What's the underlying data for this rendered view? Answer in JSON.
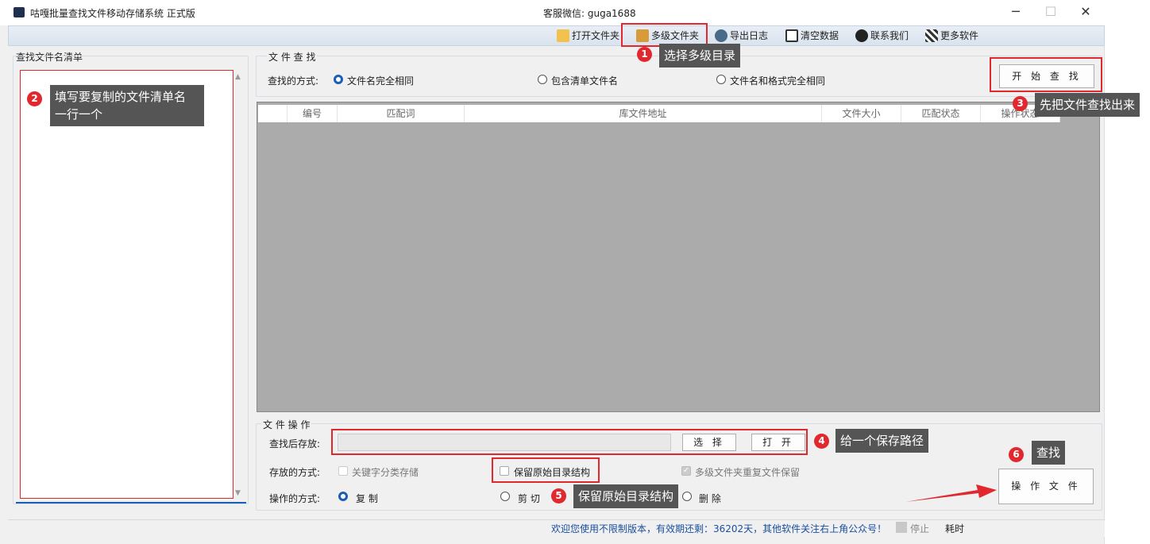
{
  "window": {
    "title": "咕嘎批量查找文件移动存储系统  正式版",
    "wechat": "客服微信: guga1688",
    "controls": {
      "minimize": "─",
      "maximize": "☐",
      "close": "✕"
    }
  },
  "toolbar": {
    "items": [
      {
        "label": "打开文件夹",
        "icon": "folder-icon"
      },
      {
        "label": "多级文件夹",
        "icon": "books-icon"
      },
      {
        "label": "导出日志",
        "icon": "gear-icon"
      },
      {
        "label": "清空数据",
        "icon": "clipboard-icon"
      },
      {
        "label": "联系我们",
        "icon": "qq-penguin-icon"
      },
      {
        "label": "更多软件",
        "icon": "qrcode-icon"
      }
    ]
  },
  "left_panel": {
    "label": "查找文件名清单"
  },
  "search": {
    "group_label": "文 件 查 找",
    "mode_label": "查找的方式:",
    "modes": [
      "文件名完全相同",
      "包含清单文件名",
      "文件名和格式完全相同"
    ],
    "selected_mode": 0,
    "start_button": "开 始 查 找"
  },
  "grid": {
    "columns": [
      "",
      "编号",
      "匹配词",
      "库文件地址",
      "文件大小",
      "匹配状态",
      "操作状态"
    ]
  },
  "file_ops": {
    "group_label": "文 件 操 作",
    "save_label": "查找后存放:",
    "save_value": "",
    "select_button": "选 择",
    "open_button": "打 开",
    "store_label": "存放的方式:",
    "options": [
      {
        "label": "关键字分类存储",
        "checked": false,
        "enabled": false
      },
      {
        "label": "保留原始目录结构",
        "checked": false,
        "enabled": true
      },
      {
        "label": "多级文件夹重复文件保留",
        "checked": true,
        "enabled": false
      }
    ],
    "op_label": "操作的方式:",
    "ops": [
      "复 制",
      "剪 切",
      "删 除"
    ],
    "selected_op": 0,
    "operate_button": "操 作 文 件"
  },
  "annotations": [
    {
      "n": "1",
      "text": "选择多级目录"
    },
    {
      "n": "2",
      "text": "填写要复制的文件清单名\n一行一个"
    },
    {
      "n": "3",
      "text": "先把文件查找出来"
    },
    {
      "n": "4",
      "text": "给一个保存路径"
    },
    {
      "n": "5",
      "text": "保留原始目录结构"
    },
    {
      "n": "6",
      "text": "查找"
    }
  ],
  "status_bar": {
    "message": "欢迎您使用不限制版本，有效期还剩：36202天，其他软件关注右上角公众号！",
    "stop": "停止",
    "elapsed": "耗时"
  },
  "colors": {
    "annotation_red": "#e0282e",
    "callout_bg": "#555555",
    "status_text": "#1a4fa0",
    "grid_bg": "#ababab"
  }
}
